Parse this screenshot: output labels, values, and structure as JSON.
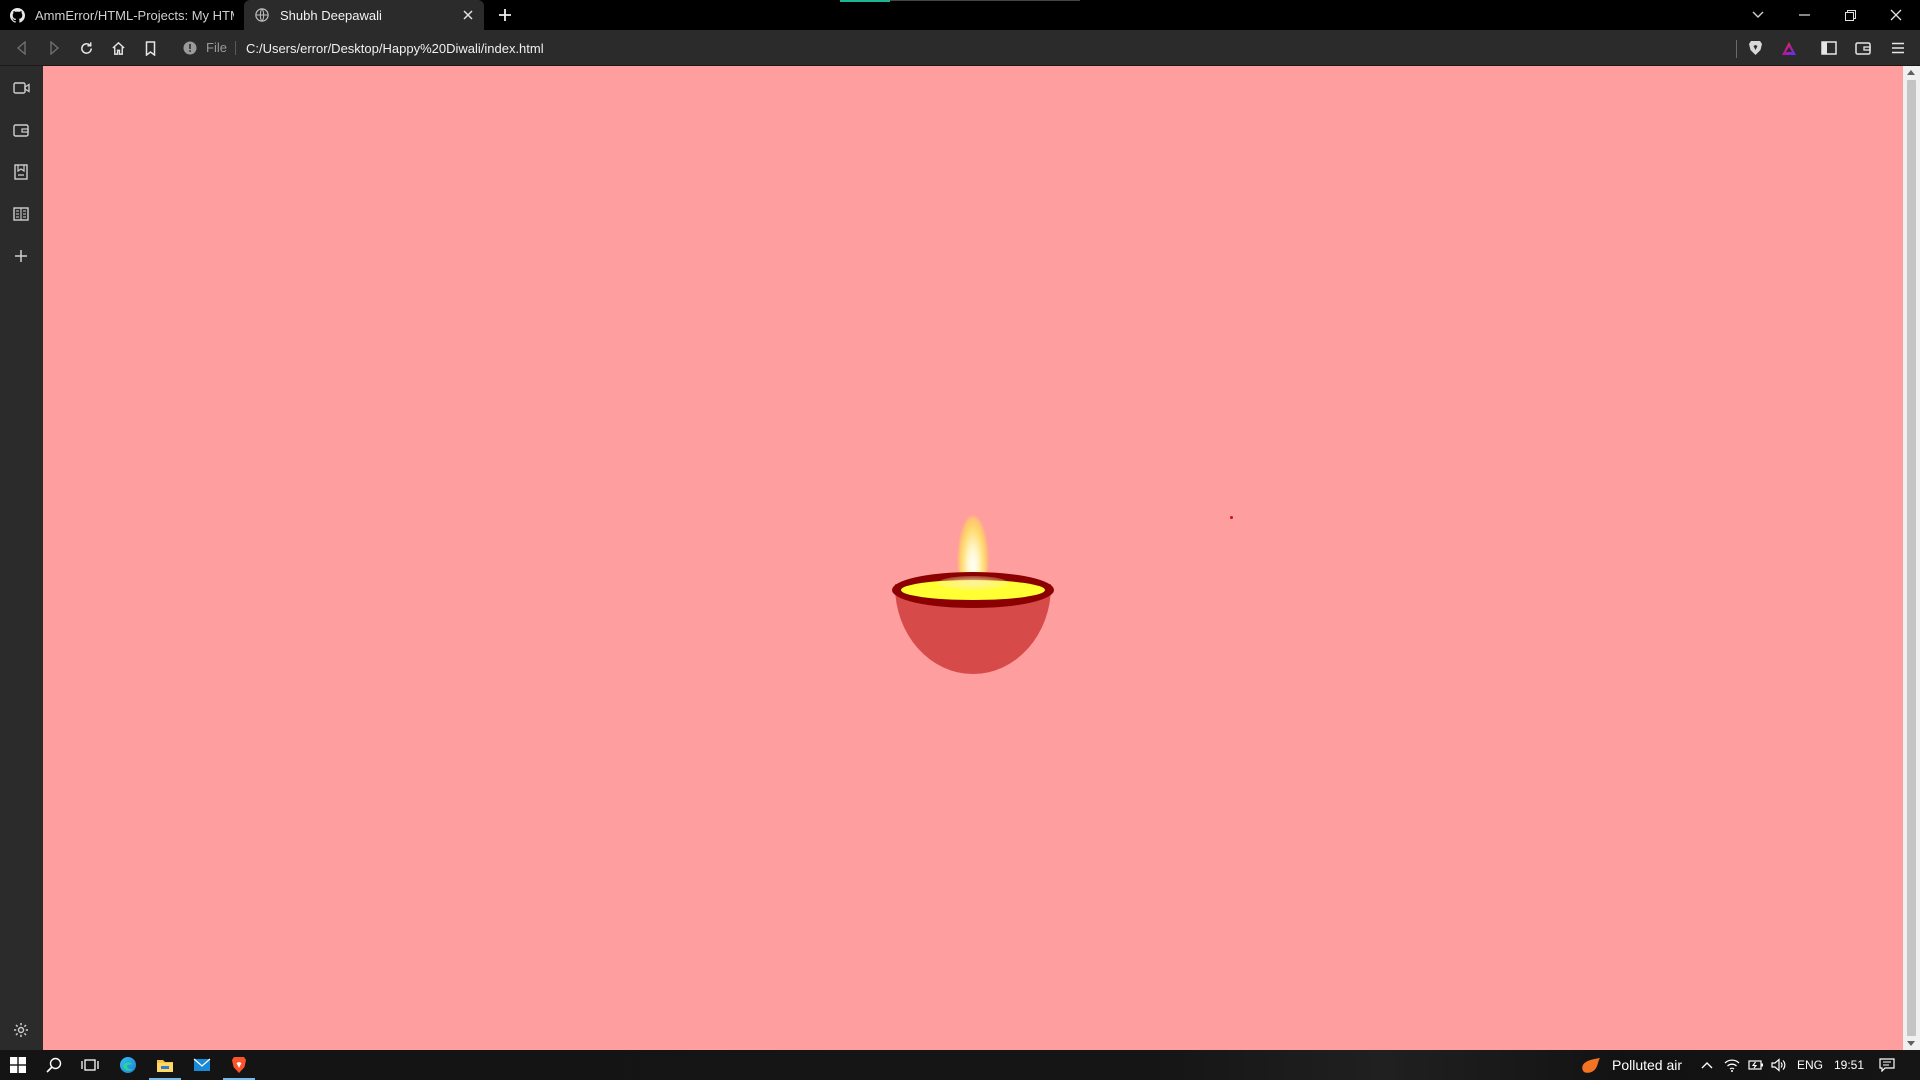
{
  "browser": {
    "tabs": [
      {
        "title": "AmmError/HTML-Projects: My HTML",
        "active": false,
        "favicon": "github-icon"
      },
      {
        "title": "Shubh Deepawali",
        "active": true,
        "favicon": "globe-icon"
      }
    ],
    "address_bar": {
      "scheme_label": "File",
      "url": "C:/Users/error/Desktop/Happy%20Diwali/index.html"
    }
  },
  "page": {
    "background_color": "#ff9e9e",
    "diya": {
      "bowl_color": "#d64a4a",
      "rim_color": "#8b0000",
      "oil_color": "#ffff33"
    }
  },
  "taskbar": {
    "weather": {
      "label": "Polluted air"
    },
    "language": "ENG",
    "time": "19:51"
  }
}
